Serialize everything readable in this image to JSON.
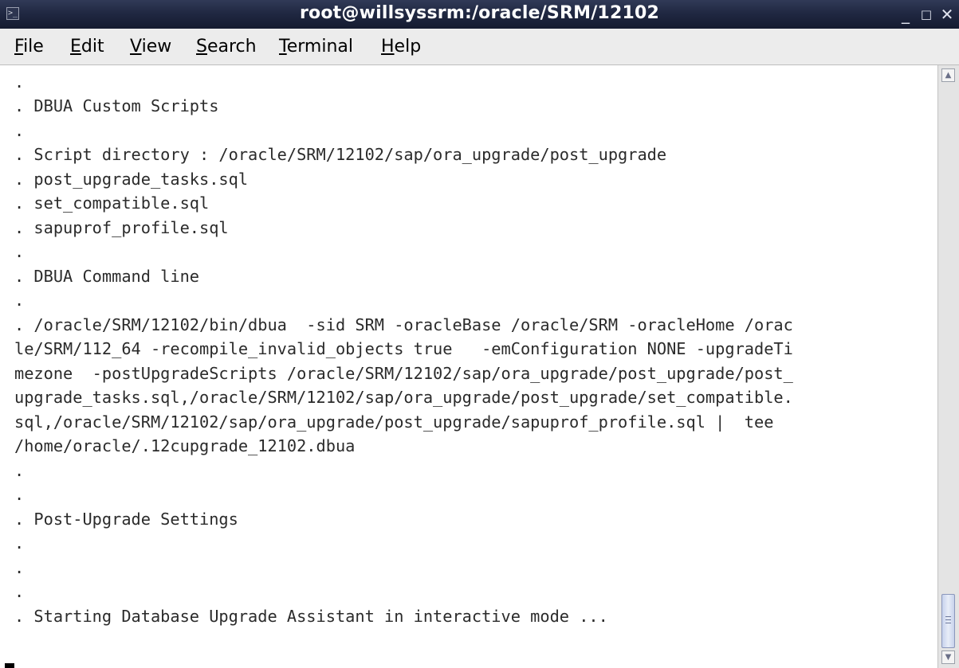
{
  "window": {
    "title": "root@willsyssrm:/oracle/SRM/12102",
    "minimize_icon": "minimize-icon",
    "maximize_icon": "maximize-icon",
    "close_icon": "close-icon",
    "app_icon": "terminal-icon"
  },
  "menu": {
    "items": [
      "File",
      "Edit",
      "View",
      "Search",
      "Terminal",
      "Help"
    ]
  },
  "terminal": {
    "lines": [
      ".",
      ". DBUA Custom Scripts",
      ".",
      ". Script directory : /oracle/SRM/12102/sap/ora_upgrade/post_upgrade",
      ". post_upgrade_tasks.sql",
      ". set_compatible.sql",
      ". sapuprof_profile.sql",
      ".",
      ". DBUA Command line",
      ".",
      ". /oracle/SRM/12102/bin/dbua  -sid SRM -oracleBase /oracle/SRM -oracleHome /orac",
      "le/SRM/112_64 -recompile_invalid_objects true   -emConfiguration NONE -upgradeTi",
      "mezone  -postUpgradeScripts /oracle/SRM/12102/sap/ora_upgrade/post_upgrade/post_",
      "upgrade_tasks.sql,/oracle/SRM/12102/sap/ora_upgrade/post_upgrade/set_compatible.",
      "sql,/oracle/SRM/12102/sap/ora_upgrade/post_upgrade/sapuprof_profile.sql |  tee",
      "/home/oracle/.12cupgrade_12102.dbua",
      ".",
      ".",
      ". Post-Upgrade Settings",
      ".",
      ".",
      ".",
      ". Starting Database Upgrade Assistant in interactive mode ..."
    ]
  },
  "colors": {
    "titlebar": "#202842",
    "menubar": "#ececec",
    "terminal_bg": "#ffffff",
    "terminal_text": "#2b2b2b"
  }
}
